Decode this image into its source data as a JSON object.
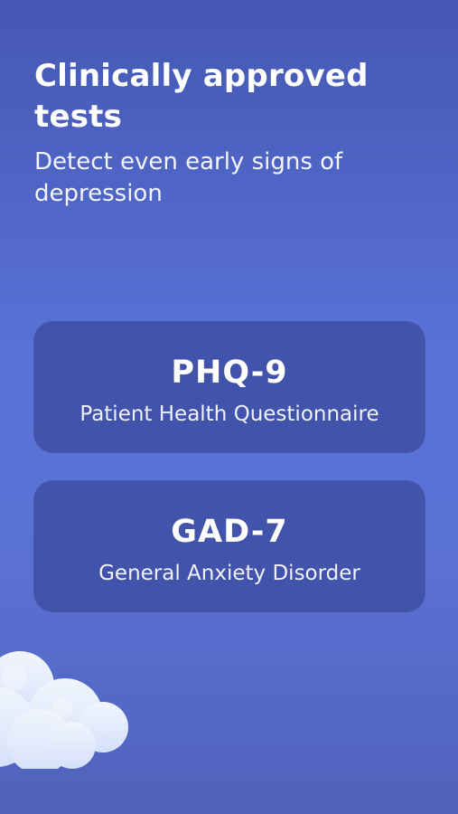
{
  "header": {
    "title": "Clinically approved tests",
    "subtitle": "Detect even early signs of depression"
  },
  "cards": [
    {
      "code": "PHQ-9",
      "name": "Patient Health Questionnaire"
    },
    {
      "code": "GAD-7",
      "name": "General Anxiety Disorder"
    }
  ],
  "decor": {
    "icon": "cloud-icon"
  }
}
